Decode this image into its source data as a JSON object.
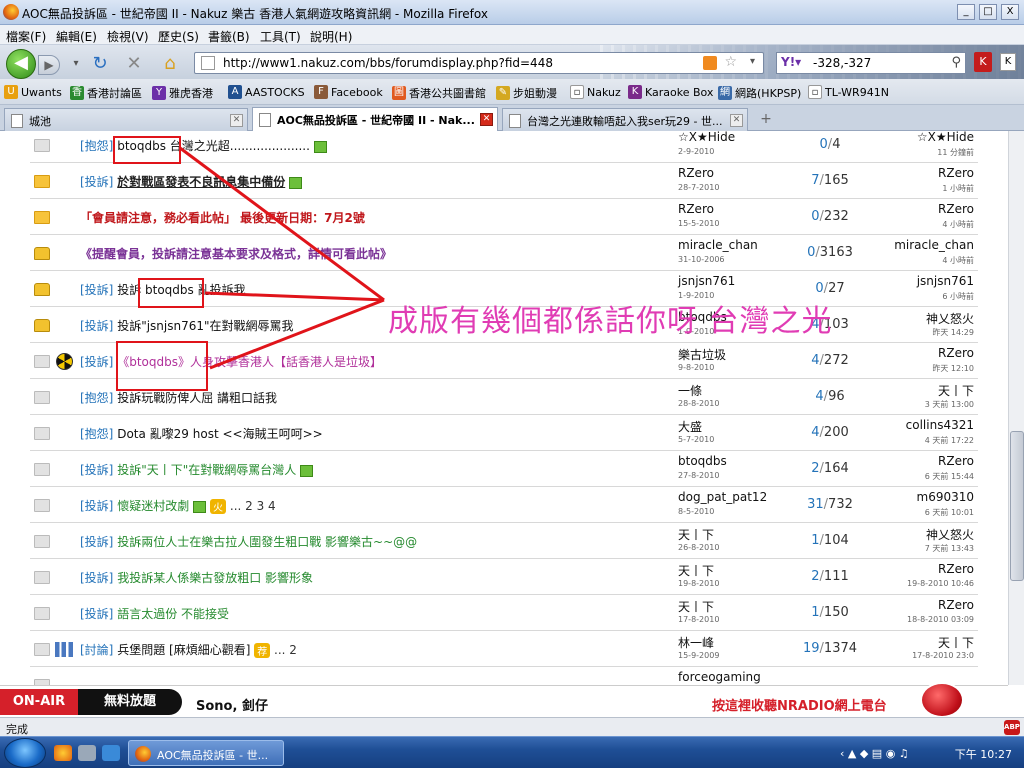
{
  "window": {
    "title": "AOC無品投訴區 - 世紀帝國 II - Nakuz 樂古 香港人氣網遊攻略資訊網 - Mozilla Firefox",
    "buttons": {
      "minimize": "_",
      "maximize": "□",
      "close": "X"
    }
  },
  "menu": [
    "檔案(F)",
    "編輯(E)",
    "檢視(V)",
    "歷史(S)",
    "書籤(B)",
    "工具(T)",
    "說明(H)"
  ],
  "nav": {
    "url": "http://www1.nakuz.com/bbs/forumdisplay.php?fid=448",
    "search_value": "-328,-327"
  },
  "bookmarks": [
    "Uwants",
    "香港討論區",
    "雅虎香港",
    "AASTOCKS",
    "Facebook",
    "香港公共圖書館",
    "步姐動漫",
    "Nakuz",
    "Karaoke Box",
    "網路(HKPSP)",
    "TL-WR941N"
  ],
  "tabs": [
    {
      "label": "城池",
      "active": false
    },
    {
      "label": "AOC無品投訴區 - 世紀帝國 II - Nak...",
      "active": true
    },
    {
      "label": "台灣之光連敗輸唔起入我ser玩29 - 世...",
      "active": false
    }
  ],
  "threads": [
    {
      "icon": "doc",
      "cat": "[抱怨]",
      "title": "btoqdbs 台灣之光超.....................",
      "title_class": "t-dark",
      "img": true,
      "author": "☆X★Hide",
      "date": "2-9-2010",
      "replies": "0",
      "views": "4",
      "last": "☆X★Hide",
      "last_time": "11 分鐘前"
    },
    {
      "icon": "folder",
      "cat": "[投訴]",
      "title": "於對戰區發表不良訊息集中備份",
      "title_class": "t-bold",
      "img": true,
      "author": "RZero",
      "date": "28-7-2010",
      "replies": "7",
      "views": "165",
      "last": "RZero",
      "last_time": "1 小時前"
    },
    {
      "icon": "folder",
      "cat": "",
      "title": "「會員請注意，務必看此帖」 最後更新日期：7月2號",
      "title_class": "t-red",
      "img": false,
      "author": "RZero",
      "date": "15-5-2010",
      "replies": "0",
      "views": "232",
      "last": "RZero",
      "last_time": "4 小時前"
    },
    {
      "icon": "lock",
      "cat": "",
      "title": "《提醒會員，投訴請注意基本要求及格式，詳情可看此帖》",
      "title_class": "t-purple",
      "img": false,
      "author": "miracle_chan",
      "date": "31-10-2006",
      "replies": "0",
      "views": "3163",
      "last": "miracle_chan",
      "last_time": "4 小時前"
    },
    {
      "icon": "lock",
      "cat": "[投訴]",
      "title": "投訴 btoqdbs 亂投訴我",
      "title_class": "t-dark",
      "img": false,
      "author": "jsnjsn761",
      "date": "1-9-2010",
      "replies": "0",
      "views": "27",
      "last": "jsnjsn761",
      "last_time": "6 小時前"
    },
    {
      "icon": "lock",
      "cat": "[投訴]",
      "title": "投訴\"jsnjsn761\"在對戰網辱罵我",
      "title_class": "t-dark",
      "img": false,
      "author": "btoqdbs",
      "date": "1-9-2010",
      "replies": "4",
      "views": "103",
      "last": "神乂怒火",
      "last_time": "昨天 14:29"
    },
    {
      "icon": "doc",
      "extra": "nuke",
      "cat": "[投訴]",
      "title": "《btoqdbs》人身攻擊香港人【話香港人是垃圾】",
      "title_class": "t-magenta",
      "img": false,
      "author": "樂古垃圾",
      "date": "9-8-2010",
      "replies": "4",
      "views": "272",
      "last": "RZero",
      "last_time": "昨天 12:10"
    },
    {
      "icon": "doc",
      "cat": "[抱怨]",
      "title": "投訴玩戰防俾人屈 講粗口話我",
      "title_class": "t-dark",
      "img": false,
      "author": "一條",
      "date": "28-8-2010",
      "replies": "4",
      "views": "96",
      "last": "天丨下",
      "last_time": "3 天前 13:00"
    },
    {
      "icon": "doc",
      "cat": "[抱怨]",
      "title": "Dota 亂嚟29 host <<海賊王呵呵>>",
      "title_class": "t-dark",
      "img": false,
      "author": "大盛",
      "date": "5-7-2010",
      "replies": "4",
      "views": "200",
      "last": "collins4321",
      "last_time": "4 天前 17:22"
    },
    {
      "icon": "doc",
      "cat": "[投訴]",
      "title": "投訴\"天丨下\"在對戰網辱罵台灣人",
      "title_class": "t-green",
      "img": true,
      "author": "btoqdbs",
      "date": "27-8-2010",
      "replies": "2",
      "views": "164",
      "last": "RZero",
      "last_time": "6 天前 15:44"
    },
    {
      "icon": "doc",
      "cat": "[投訴]",
      "title": "懷疑迷村改劇",
      "title_class": "t-green",
      "img": true,
      "hot": "火",
      "pages": "... 2  3  4",
      "author": "dog_pat_pat12",
      "date": "8-5-2010",
      "replies": "31",
      "views": "732",
      "last": "m690310",
      "last_time": "6 天前 10:01"
    },
    {
      "icon": "doc",
      "cat": "[投訴]",
      "title": "投訴兩位人士在樂古拉人圍發生粗口戰 影響樂古~~@@",
      "title_class": "t-green",
      "img": false,
      "author": "天丨下",
      "date": "26-8-2010",
      "replies": "1",
      "views": "104",
      "last": "神乂怒火",
      "last_time": "7 天前 13:43"
    },
    {
      "icon": "doc",
      "cat": "[投訴]",
      "title": "我投訴某人係樂古發放粗口 影響形象",
      "title_class": "t-green",
      "img": false,
      "author": "天丨下",
      "date": "19-8-2010",
      "replies": "2",
      "views": "111",
      "last": "RZero",
      "last_time": "19-8-2010 10:46"
    },
    {
      "icon": "doc",
      "cat": "[投訴]",
      "title": "語言太過份 不能接受",
      "title_class": "t-green",
      "img": false,
      "author": "天丨下",
      "date": "17-8-2010",
      "replies": "1",
      "views": "150",
      "last": "RZero",
      "last_time": "18-8-2010 03:09"
    },
    {
      "icon": "doc",
      "extra": "bars",
      "cat": "[討論]",
      "title": "兵堡問題 [麻煩細心觀看]",
      "title_class": "t-dark",
      "img": false,
      "hot": "荐",
      "pages": "... 2",
      "author": "林一峰",
      "date": "15-9-2009",
      "replies": "19",
      "views": "1374",
      "last": "天丨下",
      "last_time": "17-8-2010 23:0"
    },
    {
      "icon": "doc",
      "cat": "",
      "title": "",
      "title_class": "t-dark",
      "img": false,
      "author": "forceogaming",
      "date": "",
      "replies": "",
      "views": "",
      "last": "",
      "last_time": ""
    }
  ],
  "annotation": {
    "text": "成版有幾個都係話你呀 台灣之光",
    "color": "#e03cb4",
    "line_color": "#e0141a"
  },
  "radio_bar": {
    "onair": "ON-AIR",
    "free_play": "無料放題",
    "song": "Sono, 釗仔",
    "promo": "按這裡收聽NRADIO網上電台"
  },
  "status": {
    "text": "完成",
    "abp": "ABP"
  },
  "taskbar": {
    "task_label": "AOC無品投訴區 - 世...",
    "clock": "下午 10:27"
  }
}
